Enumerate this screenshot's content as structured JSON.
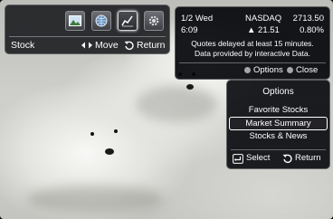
{
  "widget_bar": {
    "title": "Stock",
    "move_label": "Move",
    "return_label": "Return",
    "icons": [
      "photo-widget-icon",
      "globe-widget-icon",
      "stock-chart-widget-icon",
      "settings-widget-icon"
    ],
    "selected_icon": "stock-chart-widget-icon"
  },
  "stock_panel": {
    "date": "1/2 Wed",
    "time": "6:09",
    "index_name": "NASDAQ",
    "index_value": "2713.50",
    "change": "▲ 21.51",
    "change_percent": "0.80%",
    "notice_line1": "Quotes delayed at least 15 minutes.",
    "notice_line2": "Data provided by interactive Data.",
    "options_label": "Options",
    "close_label": "Close"
  },
  "options_panel": {
    "title": "Options",
    "items": [
      "Favorite Stocks",
      "Market Summary",
      "Stocks & News"
    ],
    "selected_item": "Market Summary",
    "select_label": "Select",
    "return_label": "Return"
  },
  "colors": {
    "panel_bg": "#06080c",
    "text": "#ffffff",
    "button_dot": "#a6a6a6",
    "highlight_border": "#ffffff"
  }
}
